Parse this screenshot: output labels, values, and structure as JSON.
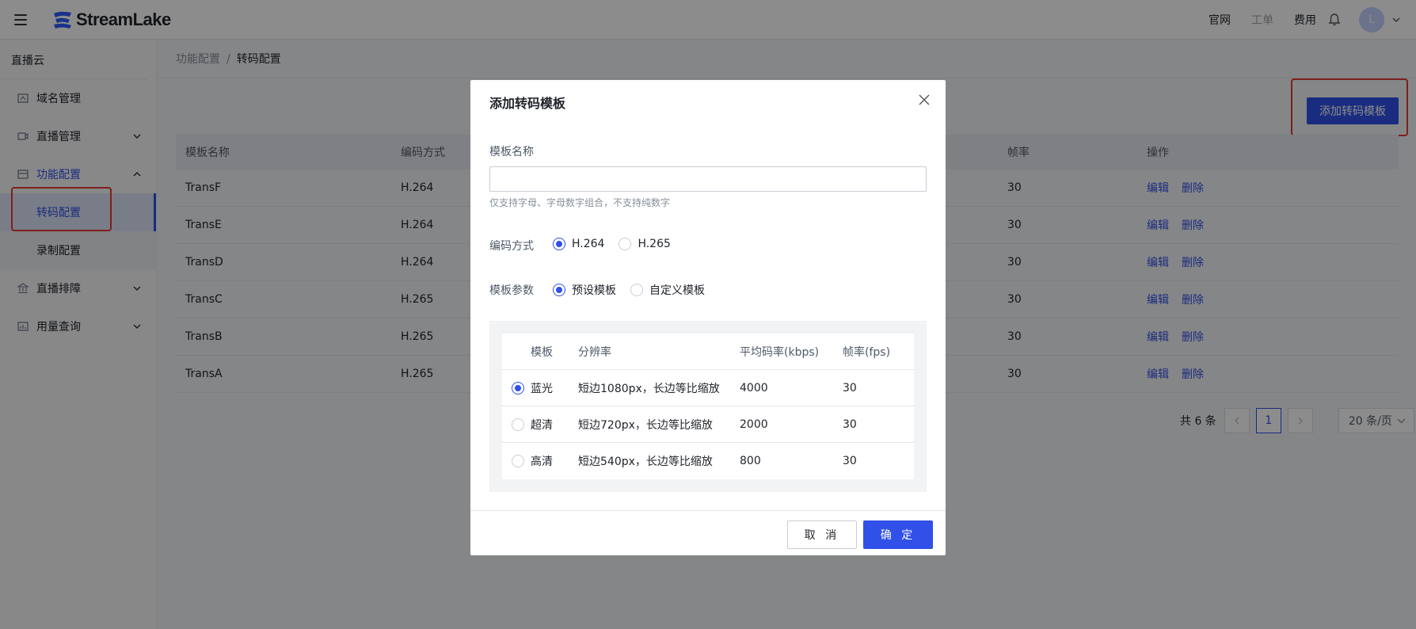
{
  "header": {
    "brand": "StreamLake",
    "links": [
      "官网",
      "工单",
      "费用"
    ],
    "avatar_letter": "L"
  },
  "sidebar": {
    "title": "直播云",
    "items": [
      {
        "label": "域名管理",
        "icon": "domain-icon"
      },
      {
        "label": "直播管理",
        "icon": "video-icon"
      },
      {
        "label": "功能配置",
        "icon": "box-icon"
      },
      {
        "label": "直播排障",
        "icon": "bank-icon"
      },
      {
        "label": "用量查询",
        "icon": "chart-icon"
      }
    ],
    "sub_items": [
      "转码配置",
      "录制配置"
    ]
  },
  "breadcrumb": {
    "parent": "功能配置",
    "sep": "/",
    "current": "转码配置"
  },
  "add_button": "添加转码模板",
  "table": {
    "headers": [
      "模板名称",
      "编码方式",
      "帧率",
      "操作"
    ],
    "rows": [
      {
        "name": "TransF",
        "codec": "H.264",
        "fps": "30"
      },
      {
        "name": "TransE",
        "codec": "H.264",
        "fps": "30"
      },
      {
        "name": "TransD",
        "codec": "H.264",
        "fps": "30"
      },
      {
        "name": "TransC",
        "codec": "H.265",
        "fps": "30"
      },
      {
        "name": "TransB",
        "codec": "H.265",
        "fps": "30"
      },
      {
        "name": "TransA",
        "codec": "H.265",
        "fps": "30"
      }
    ],
    "ops": [
      "编辑",
      "删除"
    ]
  },
  "pager": {
    "total": "共 6 条",
    "current": "1",
    "page_size": "20 条/页"
  },
  "modal": {
    "title": "添加转码模板",
    "name_label": "模板名称",
    "name_value": "",
    "name_hint": "仅支持字母、字母数字组合，不支持纯数字",
    "codec_label": "编码方式",
    "codec_options": [
      "H.264",
      "H.265"
    ],
    "codec_selected": "H.264",
    "param_label": "模板参数",
    "param_options": [
      "预设模板",
      "自定义模板"
    ],
    "param_selected": "预设模板",
    "preset_headers": [
      "模板",
      "分辨率",
      "平均码率(kbps)",
      "帧率(fps)"
    ],
    "presets": [
      {
        "name": "蓝光",
        "resolution": "短边1080px，长边等比缩放",
        "bitrate": "4000",
        "fps": "30",
        "selected": true
      },
      {
        "name": "超清",
        "resolution": "短边720px，长边等比缩放",
        "bitrate": "2000",
        "fps": "30",
        "selected": false
      },
      {
        "name": "高清",
        "resolution": "短边540px，长边等比缩放",
        "bitrate": "800",
        "fps": "30",
        "selected": false
      }
    ],
    "cancel": "取 消",
    "ok": "确 定"
  },
  "colors": {
    "accent": "#3150e8",
    "highlight": "#e53935"
  }
}
